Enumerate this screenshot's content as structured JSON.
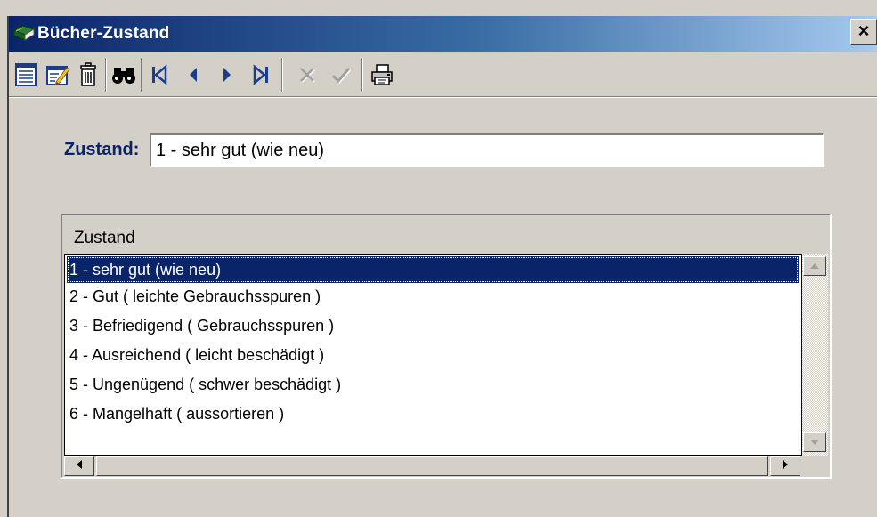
{
  "window": {
    "title": "Bücher-Zustand",
    "close_label": "×",
    "title_gradient_colors": [
      "#0a246a",
      "#3a6ea5",
      "#a6caf0"
    ]
  },
  "toolbar": {
    "buttons": [
      {
        "name": "new-record-button",
        "icon": "new-document-icon"
      },
      {
        "name": "edit-record-button",
        "icon": "edit-record-icon"
      },
      {
        "name": "delete-record-button",
        "icon": "trash-icon"
      },
      {
        "name": "search-button",
        "icon": "binoculars-icon"
      },
      {
        "name": "first-record-button",
        "icon": "first-record-icon"
      },
      {
        "name": "previous-record-button",
        "icon": "previous-record-icon"
      },
      {
        "name": "next-record-button",
        "icon": "next-record-icon"
      },
      {
        "name": "last-record-button",
        "icon": "last-record-icon"
      },
      {
        "name": "cancel-button",
        "icon": "cancel-x-icon",
        "disabled": true
      },
      {
        "name": "confirm-button",
        "icon": "checkmark-icon",
        "disabled": true
      },
      {
        "name": "print-button",
        "icon": "printer-icon"
      }
    ]
  },
  "form": {
    "field_label": "Zustand:",
    "field_value": "1 - sehr gut (wie neu)"
  },
  "grid": {
    "column_header": "Zustand",
    "selected_index": 0,
    "rows": [
      "1 - sehr gut (wie neu)",
      "2 - Gut ( leichte Gebrauchsspuren )",
      "3 - Befriedigend ( Gebrauchsspuren )",
      "4 - Ausreichend ( leicht beschädigt )",
      "5 - Ungenügend ( schwer beschädigt )",
      "6 - Mangelhaft ( aussortieren )"
    ]
  },
  "colors": {
    "face": "#d4d0c8",
    "selection": "#0a246a",
    "label": "#0a246a"
  }
}
